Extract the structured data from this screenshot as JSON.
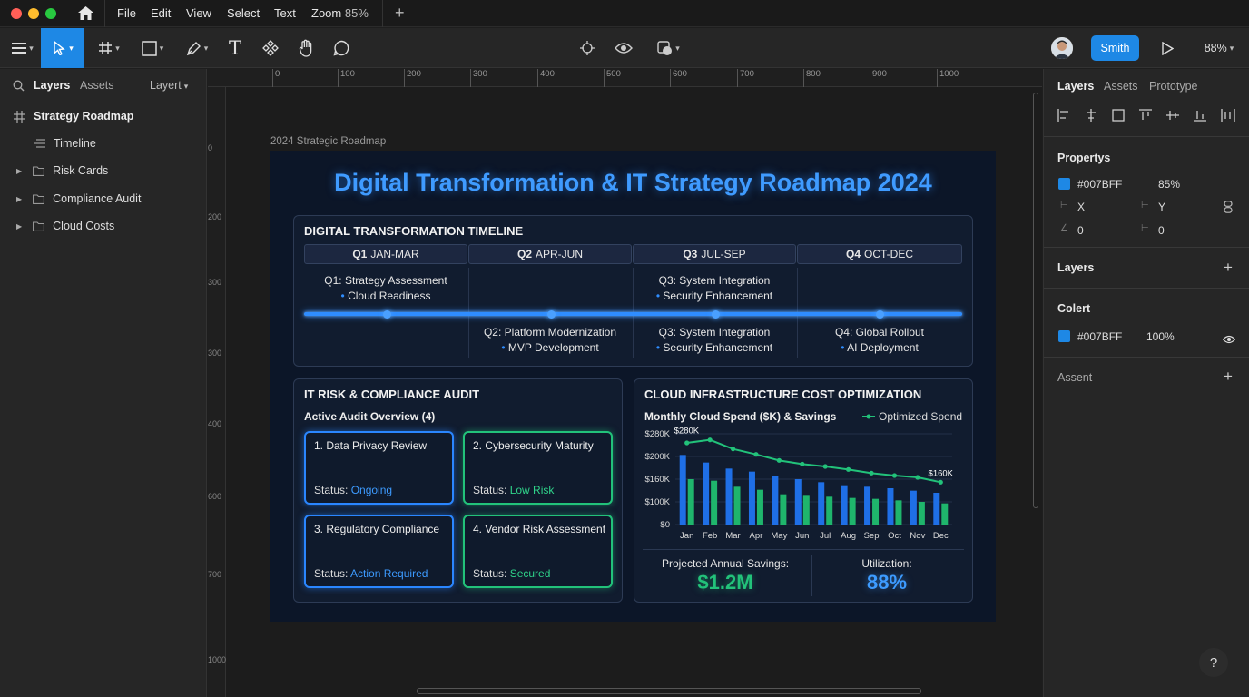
{
  "menubar": {
    "items": [
      "File",
      "Edit",
      "View",
      "Select",
      "Text"
    ],
    "zoom_label": "Zoom",
    "zoom_value": "85%",
    "new_tab": "+"
  },
  "toolbar": {
    "user_button": "Smith",
    "zoom": "88%"
  },
  "left_panel": {
    "tabs": [
      "Layers",
      "Assets"
    ],
    "layer_dropdown": "Layert",
    "root": "Strategy Roadmap",
    "children": [
      "Timeline",
      "Risk Cards",
      "Compliance Audit",
      "Cloud Costs"
    ]
  },
  "right_panel": {
    "tabs": [
      "Layers",
      "Assets",
      "Prototype"
    ],
    "properties_title": "Propertys",
    "fill_hex": "#007BFF",
    "fill_opacity": "85%",
    "x_label": "X",
    "y_label": "Y",
    "x_value": "0",
    "y_value": "0",
    "layers_title": "Layers",
    "color_title": "Colert",
    "color_hex": "#007BFF",
    "color_opacity": "100%",
    "assets_title": "Assent",
    "help": "?"
  },
  "ruler": {
    "h": [
      "0",
      "100",
      "200",
      "300",
      "400",
      "500",
      "600",
      "700",
      "800",
      "900",
      "1000"
    ],
    "v": [
      "0",
      "200",
      "300",
      "300",
      "400",
      "600",
      "700",
      "1000"
    ]
  },
  "frame_label": "2024 Strategic Roadmap",
  "design": {
    "title": "Digital Transformation & IT Strategy Roadmap 2024",
    "timeline": {
      "heading": "DIGITAL TRANSFORMATION TIMELINE",
      "quarters": [
        {
          "q": "Q1",
          "range": "JAN-MAR"
        },
        {
          "q": "Q2",
          "range": "APR-JUN"
        },
        {
          "q": "Q3",
          "range": "JUL-SEP"
        },
        {
          "q": "Q4",
          "range": "OCT-DEC"
        }
      ],
      "top": [
        {
          "line1": "Q1: Strategy Assessment",
          "line2": "Cloud Readiness"
        },
        {
          "line1": "Q3: System Integration",
          "line2": "Security Enhancement"
        }
      ],
      "bottom": [
        {
          "line1": "Q2: Platform Modernization",
          "line2": "MVP Development"
        },
        {
          "line1": "Q3: System Integration",
          "line2": "Security Enhancement"
        },
        {
          "line1": "Q4: Global Rollout",
          "line2": "AI Deployment"
        }
      ]
    },
    "audit": {
      "heading": "IT RISK & COMPLIANCE AUDIT",
      "subheading": "Active Audit Overview (4)",
      "status_label": "Status:",
      "cards": [
        {
          "title": "1. Data Privacy Review",
          "status": "Ongoing"
        },
        {
          "title": "2. Cybersecurity Maturity",
          "status": "Low Risk"
        },
        {
          "title": "3. Regulatory Compliance",
          "status": "Action Required"
        },
        {
          "title": "4. Vendor Risk Assessment",
          "status": "Secured"
        }
      ]
    },
    "cloud": {
      "heading": "CLOUD INFRASTRUCTURE COST OPTIMIZATION",
      "chart_title": "Monthly Cloud Spend ($K) & Savings",
      "legend": "Optimized Spend",
      "savings_label": "Projected Annual Savings:",
      "savings_value": "$1.2M",
      "util_label": "Utilization:",
      "util_value": "88%"
    }
  },
  "chart_data": {
    "type": "bar",
    "title": "Monthly Cloud Spend ($K) & Savings",
    "categories": [
      "Jan",
      "Feb",
      "Mar",
      "Apr",
      "May",
      "Jun",
      "Jul",
      "Aug",
      "Sep",
      "Oct",
      "Nov",
      "Dec"
    ],
    "y_ticks": [
      "$280K",
      "$200K",
      "$160K",
      "$100K",
      "$0"
    ],
    "ylim": [
      0,
      300
    ],
    "series": [
      {
        "values": [
          230,
          205,
          185,
          175,
          160,
          150,
          140,
          130,
          125,
          120,
          112,
          105
        ],
        "color": "#1f6fe6"
      },
      {
        "values": [
          150,
          145,
          125,
          115,
          100,
          98,
          92,
          88,
          85,
          80,
          75,
          70
        ],
        "color": "#1fb56c"
      },
      {
        "name": "Optimized Spend",
        "type": "line",
        "values": [
          270,
          280,
          250,
          232,
          212,
          200,
          192,
          182,
          170,
          162,
          156,
          140
        ],
        "color": "#22c27a"
      }
    ],
    "annotations": [
      {
        "x": "Feb",
        "text": "$280K"
      },
      {
        "x": "Dec",
        "text": "$160K"
      }
    ],
    "legend": "top-right"
  }
}
